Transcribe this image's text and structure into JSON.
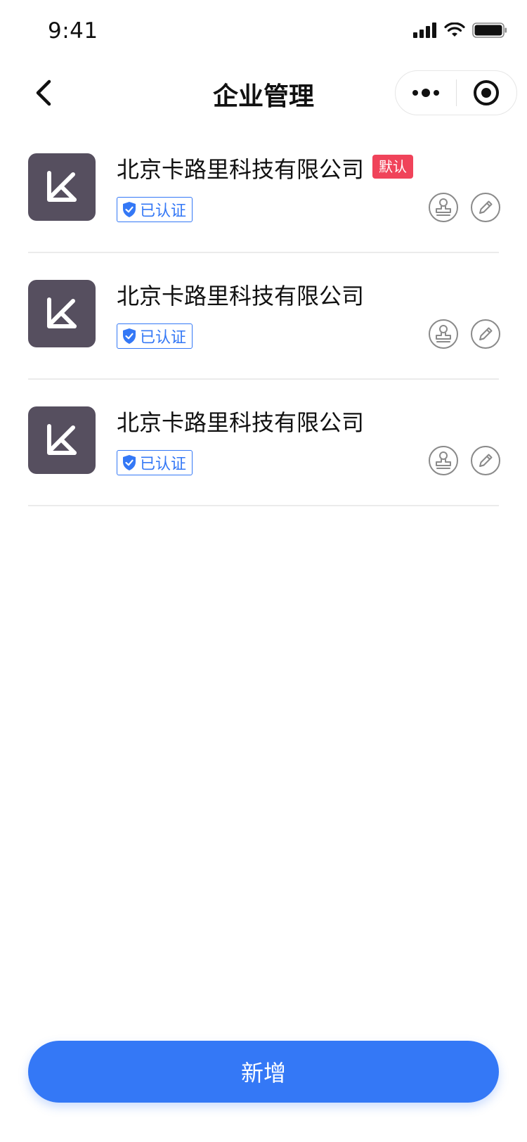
{
  "status_bar": {
    "time": "9:41"
  },
  "nav": {
    "title": "企业管理"
  },
  "companies": [
    {
      "name": "北京卡路里科技有限公司",
      "default_tag": "默认",
      "verified": "已认证"
    },
    {
      "name": "北京卡路里科技有限公司",
      "verified": "已认证"
    },
    {
      "name": "北京卡路里科技有限公司",
      "verified": "已认证"
    }
  ],
  "actions": {
    "add_label": "新增"
  },
  "icons": {
    "back": "chevron-left-icon",
    "more": "more-dots-icon",
    "close": "target-circle-icon",
    "seal": "stamp-icon",
    "edit": "pencil-icon",
    "verified": "shield-check-icon",
    "logo": "k-logo-icon"
  },
  "colors": {
    "primary": "#3478f6",
    "default_tag": "#f0435a",
    "logo_bg": "#564f5f"
  }
}
